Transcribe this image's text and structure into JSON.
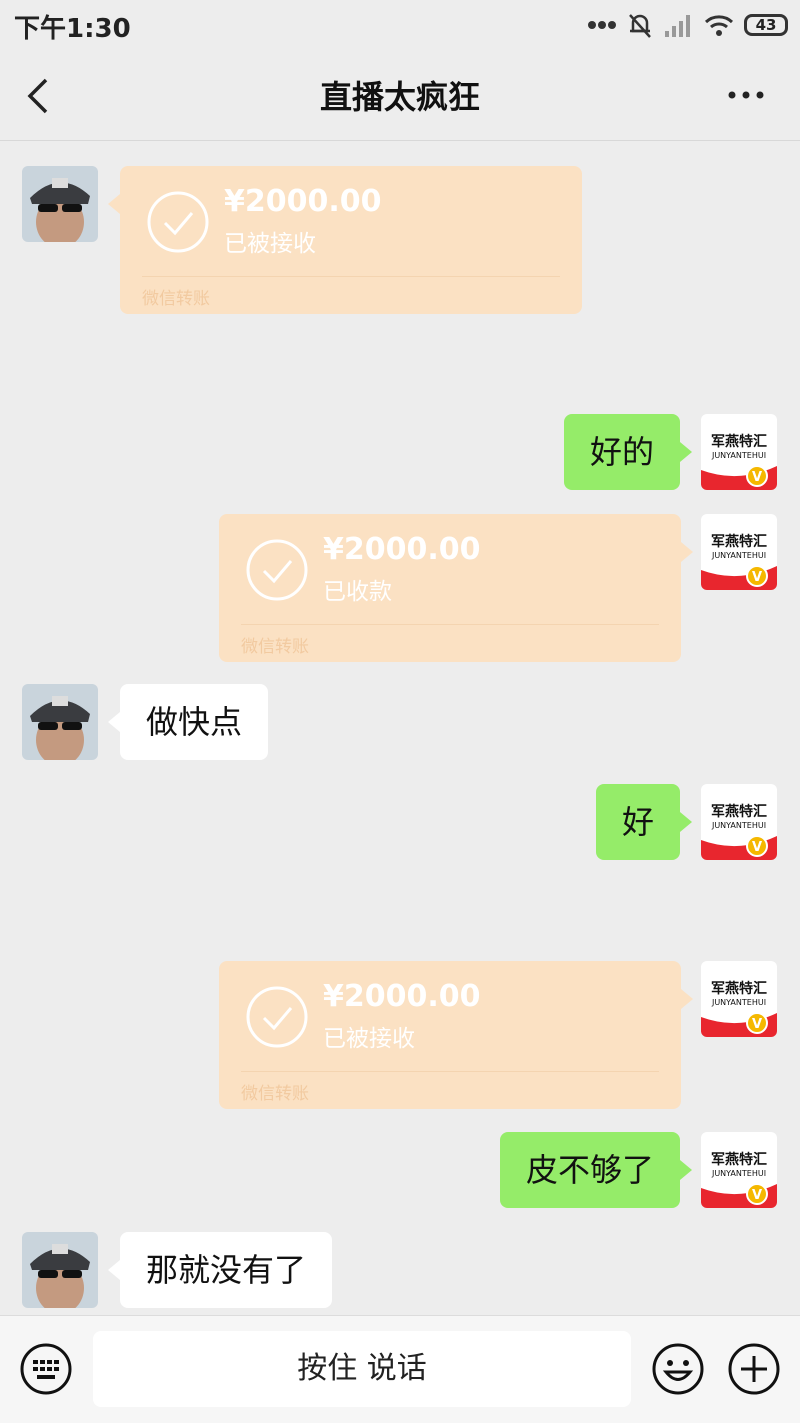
{
  "status_bar": {
    "time": "下午1:30",
    "battery": "43",
    "icons": [
      "dots-icon",
      "mute-bell-icon",
      "signal-icon",
      "wifi-icon",
      "battery-icon"
    ]
  },
  "header": {
    "title": "直播太疯狂",
    "back_icon": "chevron-left-icon",
    "more_icon": "ellipsis-icon"
  },
  "messages": [
    {
      "side": "left",
      "type": "transfer",
      "amount": "¥2000.00",
      "status": "已被接收",
      "footer": "微信转账"
    },
    {
      "side": "right",
      "type": "text",
      "text": "好的"
    },
    {
      "side": "right",
      "type": "transfer",
      "amount": "¥2000.00",
      "status": "已收款",
      "footer": "微信转账"
    },
    {
      "side": "left",
      "type": "text",
      "text": "做快点"
    },
    {
      "side": "right",
      "type": "text",
      "text": "好"
    },
    {
      "side": "right",
      "type": "transfer",
      "amount": "¥2000.00",
      "status": "已被接收",
      "footer": "微信转账"
    },
    {
      "side": "right",
      "type": "text",
      "text": "皮不够了"
    },
    {
      "side": "left",
      "type": "text",
      "text": "那就没有了"
    }
  ],
  "my_avatar": {
    "logo_text": "军燕特汇",
    "logo_subtext": "JUNYANTEHUI",
    "badge": "V"
  },
  "input_bar": {
    "hold_to_talk": "按住 说话",
    "keyboard_icon": "keyboard-icon",
    "emoji_icon": "emoji-icon",
    "plus_icon": "plus-icon"
  },
  "colors": {
    "background": "#ededed",
    "my_bubble": "#95ec69",
    "other_bubble": "#ffffff",
    "transfer_card": "#fbe1c3"
  }
}
